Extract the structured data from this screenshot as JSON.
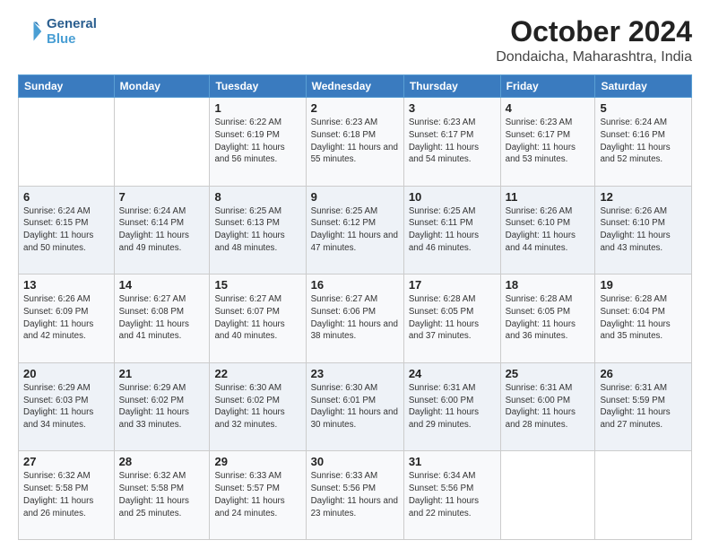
{
  "logo": {
    "line1": "General",
    "line2": "Blue"
  },
  "title": "October 2024",
  "subtitle": "Dondaicha, Maharashtra, India",
  "days_of_week": [
    "Sunday",
    "Monday",
    "Tuesday",
    "Wednesday",
    "Thursday",
    "Friday",
    "Saturday"
  ],
  "weeks": [
    [
      {
        "day": "",
        "info": ""
      },
      {
        "day": "",
        "info": ""
      },
      {
        "day": "1",
        "info": "Sunrise: 6:22 AM\nSunset: 6:19 PM\nDaylight: 11 hours and 56 minutes."
      },
      {
        "day": "2",
        "info": "Sunrise: 6:23 AM\nSunset: 6:18 PM\nDaylight: 11 hours and 55 minutes."
      },
      {
        "day": "3",
        "info": "Sunrise: 6:23 AM\nSunset: 6:17 PM\nDaylight: 11 hours and 54 minutes."
      },
      {
        "day": "4",
        "info": "Sunrise: 6:23 AM\nSunset: 6:17 PM\nDaylight: 11 hours and 53 minutes."
      },
      {
        "day": "5",
        "info": "Sunrise: 6:24 AM\nSunset: 6:16 PM\nDaylight: 11 hours and 52 minutes."
      }
    ],
    [
      {
        "day": "6",
        "info": "Sunrise: 6:24 AM\nSunset: 6:15 PM\nDaylight: 11 hours and 50 minutes."
      },
      {
        "day": "7",
        "info": "Sunrise: 6:24 AM\nSunset: 6:14 PM\nDaylight: 11 hours and 49 minutes."
      },
      {
        "day": "8",
        "info": "Sunrise: 6:25 AM\nSunset: 6:13 PM\nDaylight: 11 hours and 48 minutes."
      },
      {
        "day": "9",
        "info": "Sunrise: 6:25 AM\nSunset: 6:12 PM\nDaylight: 11 hours and 47 minutes."
      },
      {
        "day": "10",
        "info": "Sunrise: 6:25 AM\nSunset: 6:11 PM\nDaylight: 11 hours and 46 minutes."
      },
      {
        "day": "11",
        "info": "Sunrise: 6:26 AM\nSunset: 6:10 PM\nDaylight: 11 hours and 44 minutes."
      },
      {
        "day": "12",
        "info": "Sunrise: 6:26 AM\nSunset: 6:10 PM\nDaylight: 11 hours and 43 minutes."
      }
    ],
    [
      {
        "day": "13",
        "info": "Sunrise: 6:26 AM\nSunset: 6:09 PM\nDaylight: 11 hours and 42 minutes."
      },
      {
        "day": "14",
        "info": "Sunrise: 6:27 AM\nSunset: 6:08 PM\nDaylight: 11 hours and 41 minutes."
      },
      {
        "day": "15",
        "info": "Sunrise: 6:27 AM\nSunset: 6:07 PM\nDaylight: 11 hours and 40 minutes."
      },
      {
        "day": "16",
        "info": "Sunrise: 6:27 AM\nSunset: 6:06 PM\nDaylight: 11 hours and 38 minutes."
      },
      {
        "day": "17",
        "info": "Sunrise: 6:28 AM\nSunset: 6:05 PM\nDaylight: 11 hours and 37 minutes."
      },
      {
        "day": "18",
        "info": "Sunrise: 6:28 AM\nSunset: 6:05 PM\nDaylight: 11 hours and 36 minutes."
      },
      {
        "day": "19",
        "info": "Sunrise: 6:28 AM\nSunset: 6:04 PM\nDaylight: 11 hours and 35 minutes."
      }
    ],
    [
      {
        "day": "20",
        "info": "Sunrise: 6:29 AM\nSunset: 6:03 PM\nDaylight: 11 hours and 34 minutes."
      },
      {
        "day": "21",
        "info": "Sunrise: 6:29 AM\nSunset: 6:02 PM\nDaylight: 11 hours and 33 minutes."
      },
      {
        "day": "22",
        "info": "Sunrise: 6:30 AM\nSunset: 6:02 PM\nDaylight: 11 hours and 32 minutes."
      },
      {
        "day": "23",
        "info": "Sunrise: 6:30 AM\nSunset: 6:01 PM\nDaylight: 11 hours and 30 minutes."
      },
      {
        "day": "24",
        "info": "Sunrise: 6:31 AM\nSunset: 6:00 PM\nDaylight: 11 hours and 29 minutes."
      },
      {
        "day": "25",
        "info": "Sunrise: 6:31 AM\nSunset: 6:00 PM\nDaylight: 11 hours and 28 minutes."
      },
      {
        "day": "26",
        "info": "Sunrise: 6:31 AM\nSunset: 5:59 PM\nDaylight: 11 hours and 27 minutes."
      }
    ],
    [
      {
        "day": "27",
        "info": "Sunrise: 6:32 AM\nSunset: 5:58 PM\nDaylight: 11 hours and 26 minutes."
      },
      {
        "day": "28",
        "info": "Sunrise: 6:32 AM\nSunset: 5:58 PM\nDaylight: 11 hours and 25 minutes."
      },
      {
        "day": "29",
        "info": "Sunrise: 6:33 AM\nSunset: 5:57 PM\nDaylight: 11 hours and 24 minutes."
      },
      {
        "day": "30",
        "info": "Sunrise: 6:33 AM\nSunset: 5:56 PM\nDaylight: 11 hours and 23 minutes."
      },
      {
        "day": "31",
        "info": "Sunrise: 6:34 AM\nSunset: 5:56 PM\nDaylight: 11 hours and 22 minutes."
      },
      {
        "day": "",
        "info": ""
      },
      {
        "day": "",
        "info": ""
      }
    ]
  ]
}
